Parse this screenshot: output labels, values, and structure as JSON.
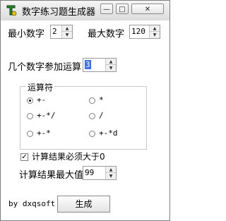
{
  "window": {
    "title": "数字练习题生成器"
  },
  "titlebar_buttons": {
    "minimize": "—",
    "maximize": "□",
    "close": "✕"
  },
  "min_number": {
    "label": "最小数字",
    "value": "2"
  },
  "max_number": {
    "label": "最大数字",
    "value": "120"
  },
  "operand_count": {
    "label": "几个数字参加运算",
    "value": "3"
  },
  "operators": {
    "group_label": "运算符",
    "options": [
      {
        "label": "+-",
        "selected": true
      },
      {
        "label": "*",
        "selected": false
      },
      {
        "label": "+-*/",
        "selected": false
      },
      {
        "label": "/",
        "selected": false
      },
      {
        "label": "+-*",
        "selected": false
      },
      {
        "label": "+-*d",
        "selected": false
      }
    ]
  },
  "positive_result": {
    "label": "计算结果必须大于0",
    "checked": true
  },
  "max_result": {
    "label": "计算结果最大值",
    "value": "99"
  },
  "footer": {
    "author": "by dxqsoft",
    "generate_label": "生成"
  }
}
